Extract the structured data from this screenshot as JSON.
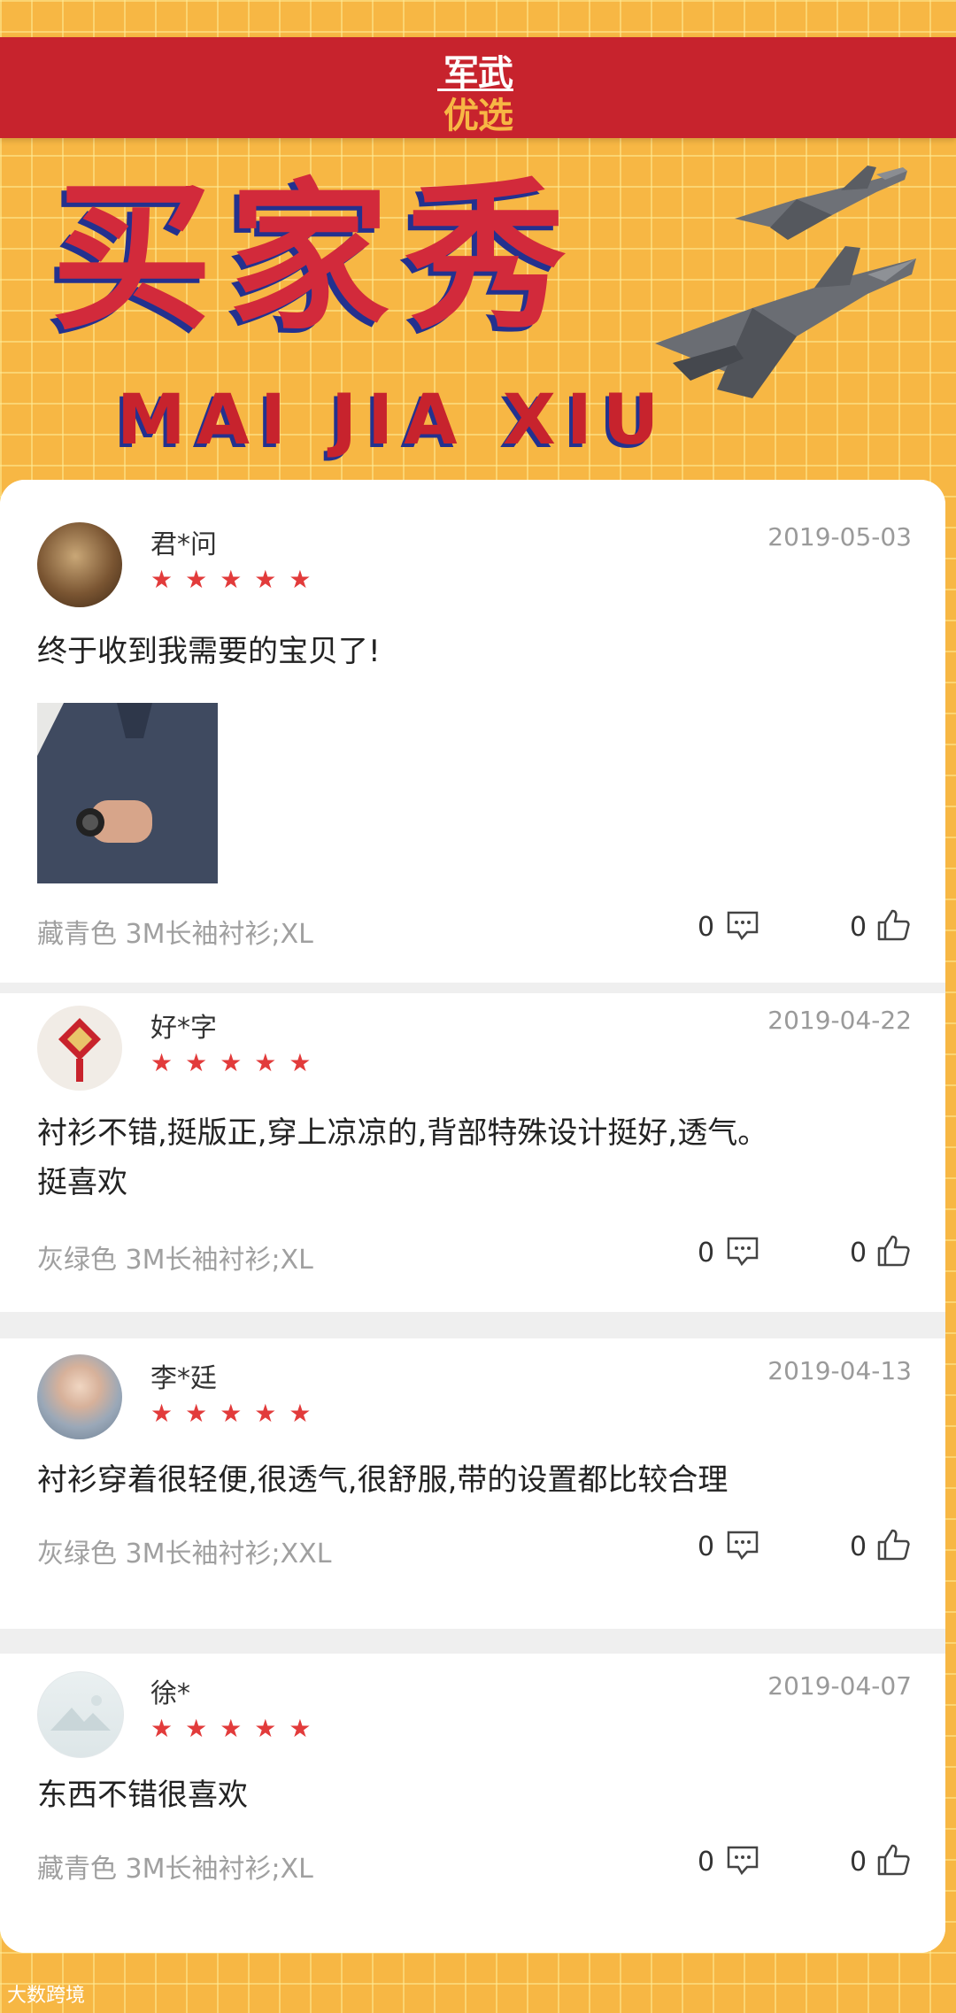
{
  "header": {
    "brand_top": "军武",
    "brand_bottom": "优选",
    "title": "买家秀",
    "subtitle": "MAI JIA XIU"
  },
  "reviews": [
    {
      "user": "君*问",
      "date": "2019-05-03",
      "rating": 5,
      "stars": "★★★★★",
      "comment": "终于收到我需要的宝贝了!",
      "spec": "藏青色 3M长袖衬衫;XL",
      "comment_count": "0",
      "like_count": "0"
    },
    {
      "user": "好*字",
      "date": "2019-04-22",
      "rating": 5,
      "stars": "★★★★★",
      "comment_line1": "衬衫不错,挺版正,穿上凉凉的,背部特殊设计挺好,透气。",
      "comment_line2": "挺喜欢",
      "spec": "灰绿色 3M长袖衬衫;XL",
      "comment_count": "0",
      "like_count": "0"
    },
    {
      "user": "李*廷",
      "date": "2019-04-13",
      "rating": 5,
      "stars": "★★★★★",
      "comment": "衬衫穿着很轻便,很透气,很舒服,带的设置都比较合理",
      "spec": "灰绿色 3M长袖衬衫;XXL",
      "comment_count": "0",
      "like_count": "0"
    },
    {
      "user": "徐*",
      "date": "2019-04-07",
      "rating": 5,
      "stars": "★★★★★",
      "comment": "东西不错很喜欢",
      "spec": "藏青色 3M长袖衬衫;XL",
      "comment_count": "0",
      "like_count": "0"
    }
  ],
  "watermark": "大数跨境",
  "colors": {
    "background": "#F7B744",
    "banner": "#C7232D",
    "title_red": "#D22A3B",
    "title_shadow": "#23318F",
    "star": "#E23B3B"
  }
}
